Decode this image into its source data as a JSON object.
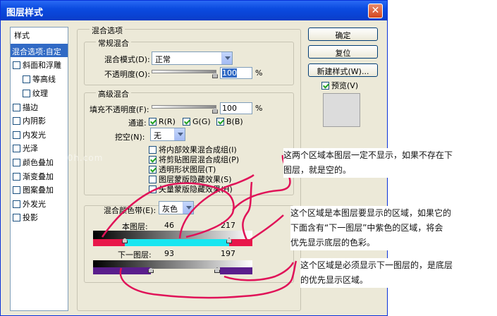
{
  "window": {
    "title": "图层样式",
    "close": "✕"
  },
  "sidebar": {
    "header": "样式",
    "items": [
      {
        "label": "混合选项:自定",
        "checkbox": false,
        "selected": true
      },
      {
        "label": "斜面和浮雕",
        "checkbox": true,
        "checked": false
      },
      {
        "label": "等高线",
        "checkbox": true,
        "checked": false
      },
      {
        "label": "纹理",
        "checkbox": true,
        "checked": false
      },
      {
        "label": "描边",
        "checkbox": true,
        "checked": false
      },
      {
        "label": "内阴影",
        "checkbox": true,
        "checked": false
      },
      {
        "label": "内发光",
        "checkbox": true,
        "checked": false
      },
      {
        "label": "光泽",
        "checkbox": true,
        "checked": false
      },
      {
        "label": "颜色叠加",
        "checkbox": true,
        "checked": false
      },
      {
        "label": "渐变叠加",
        "checkbox": true,
        "checked": false
      },
      {
        "label": "图案叠加",
        "checkbox": true,
        "checked": false
      },
      {
        "label": "外发光",
        "checkbox": true,
        "checked": false
      },
      {
        "label": "投影",
        "checkbox": true,
        "checked": false
      }
    ]
  },
  "blend": {
    "title": "混合选项",
    "general": {
      "title": "常规混合",
      "mode_label": "混合模式(D):",
      "mode_value": "正常",
      "opacity_label": "不透明度(O):",
      "opacity_value": "100",
      "opacity_unit": "%"
    },
    "advanced": {
      "title": "高级混合",
      "fill_label": "填充不透明度(F):",
      "fill_value": "100",
      "fill_unit": "%",
      "channels_label": "通道:",
      "channel_r": "R(R)",
      "channel_g": "G(G)",
      "channel_b": "B(B)",
      "knockout_label": "挖空(N):",
      "knockout_value": "无",
      "options": [
        {
          "label": "将内部效果混合成组(I)",
          "checked": false
        },
        {
          "label": "将剪贴图层混合成组(P)",
          "checked": true
        },
        {
          "label": "透明形状图层(T)",
          "checked": true
        },
        {
          "label": "图层蒙版隐藏效果(S)",
          "checked": false
        },
        {
          "label": "矢量蒙版隐藏效果(H)",
          "checked": false
        }
      ]
    },
    "blend_if": {
      "label": "混合颜色带(E):",
      "value": "灰色",
      "this_layer_label": "本图层:",
      "this_low": "46",
      "this_high": "217",
      "under_layer_label": "下一图层:",
      "under_low": "93",
      "under_high": "197"
    }
  },
  "buttons": {
    "ok": "确定",
    "reset": "复位",
    "new_style": "新建样式(W)...",
    "preview": "预览(V)"
  },
  "annotations": [
    {
      "lines": [
        "这两个区域本图层一定不显示，如果不存在下",
        "图层，就是空的。"
      ]
    },
    {
      "lines": [
        "这个区域是本图层要显示的区域，如果它的",
        "下面含有“下一图层”中紫色的区域，将会",
        "优先显示底层的色彩。"
      ]
    },
    {
      "lines": [
        "这个区域是必须显示下一图层的，是底层",
        "的优先显示区域。"
      ]
    }
  ],
  "watermark": "www.tutu0h.com",
  "colors": {
    "title_bar": "#0a46dc",
    "selected": "#316ac5",
    "this_layer_hidden": "#e8174a",
    "this_layer_shown": "#19e6f0",
    "under_layer_forced": "#5a1e8c",
    "marker_ink": "#e01258"
  }
}
